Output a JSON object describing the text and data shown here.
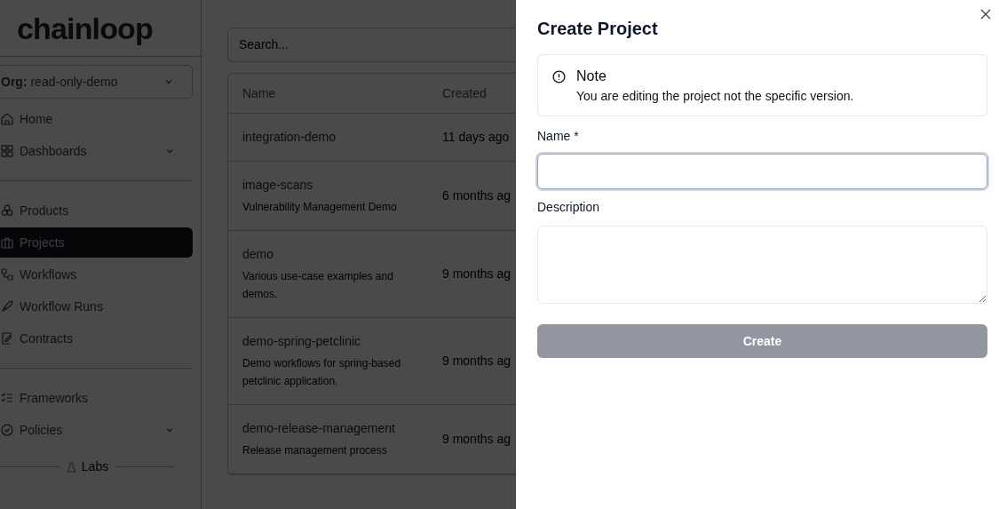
{
  "logo": "chainloop",
  "org": {
    "label": "Org:",
    "value": "read-only-demo"
  },
  "nav": [
    {
      "kind": "item",
      "label": "Home",
      "selected": false,
      "expandable": false
    },
    {
      "kind": "item",
      "label": "Dashboards",
      "selected": false,
      "expandable": true
    },
    {
      "kind": "divider"
    },
    {
      "kind": "item",
      "label": "Products",
      "selected": false,
      "expandable": false
    },
    {
      "kind": "item",
      "label": "Projects",
      "selected": true,
      "expandable": false
    },
    {
      "kind": "item",
      "label": "Workflows",
      "selected": false,
      "expandable": false
    },
    {
      "kind": "item",
      "label": "Workflow Runs",
      "selected": false,
      "expandable": false
    },
    {
      "kind": "item",
      "label": "Contracts",
      "selected": false,
      "expandable": false
    },
    {
      "kind": "divider"
    },
    {
      "kind": "item",
      "label": "Frameworks",
      "selected": false,
      "expandable": false
    },
    {
      "kind": "item",
      "label": "Policies",
      "selected": false,
      "expandable": true
    },
    {
      "kind": "section",
      "label": "Labs"
    }
  ],
  "search": {
    "placeholder": "Search..."
  },
  "table": {
    "columns": [
      "Name",
      "Created"
    ],
    "rows": [
      {
        "name": "integration-demo",
        "description": "",
        "created": "11 days ago"
      },
      {
        "name": "image-scans",
        "description": "Vulnerability Management Demo",
        "created": "6 months ag"
      },
      {
        "name": "demo",
        "description": "Various use-case examples and demos.",
        "created": "9 months ag"
      },
      {
        "name": "demo-spring-petclinic",
        "description": "Demo workflows for spring-based petclinic application.",
        "created": "9 months ag"
      },
      {
        "name": "demo-release-management",
        "description": "Release management process",
        "created": "9 months ag"
      }
    ]
  },
  "drawer": {
    "title": "Create Project",
    "note": {
      "title": "Note",
      "text": "You are editing the project not the specific version."
    },
    "fields": [
      {
        "kind": "input",
        "label": "Name *",
        "focused": true
      },
      {
        "kind": "textarea",
        "label": "Description",
        "focused": false
      }
    ],
    "submit": {
      "label": "Create",
      "disabled": true
    }
  }
}
